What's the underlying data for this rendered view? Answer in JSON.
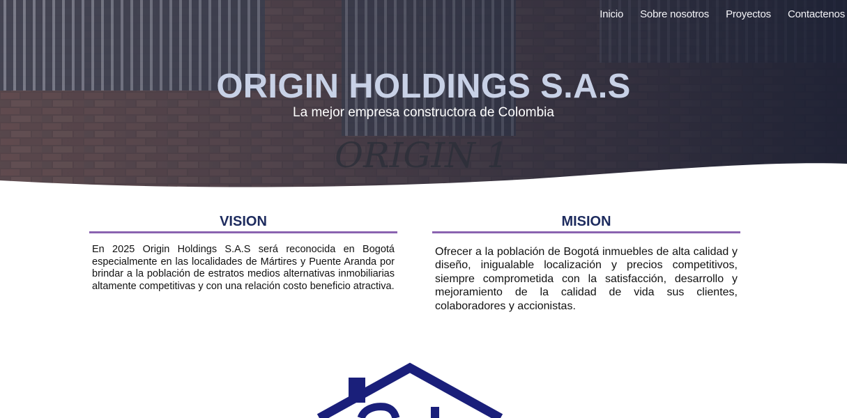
{
  "nav": {
    "items": [
      {
        "label": "Inicio"
      },
      {
        "label": "Sobre nosotros"
      },
      {
        "label": "Proyectos"
      },
      {
        "label": "Contactenos"
      }
    ]
  },
  "hero": {
    "title": "ORIGIN HOLDINGS S.A.S",
    "subtitle": "La mejor empresa constructora de Colombia",
    "background_graffiti": "ORIGIN 1"
  },
  "vision": {
    "heading": "VISION",
    "text": "En 2025 Origin Holdings S.A.S será reconocida en Bogotá especialmente en las localidades de Mártires y Puente Aranda por brindar a la población de estratos medios alternativas inmobiliarias altamente competitivas y con una relación costo beneficio atractiva."
  },
  "mision": {
    "heading": "MISION",
    "text": "Ofrecer a la población de Bogotá inmuebles de alta calidad y diseño, inigualable localización y precios competitivos, siempre comprometida con la satisfacción, desarrollo y mejoramiento de la calidad de vida sus clientes, colaboradores y accionistas."
  },
  "colors": {
    "heading": "#1d2b5e",
    "rule": "#8a63b0",
    "hero_title": "#c8d1e6",
    "logo": "#1a1f7a"
  }
}
